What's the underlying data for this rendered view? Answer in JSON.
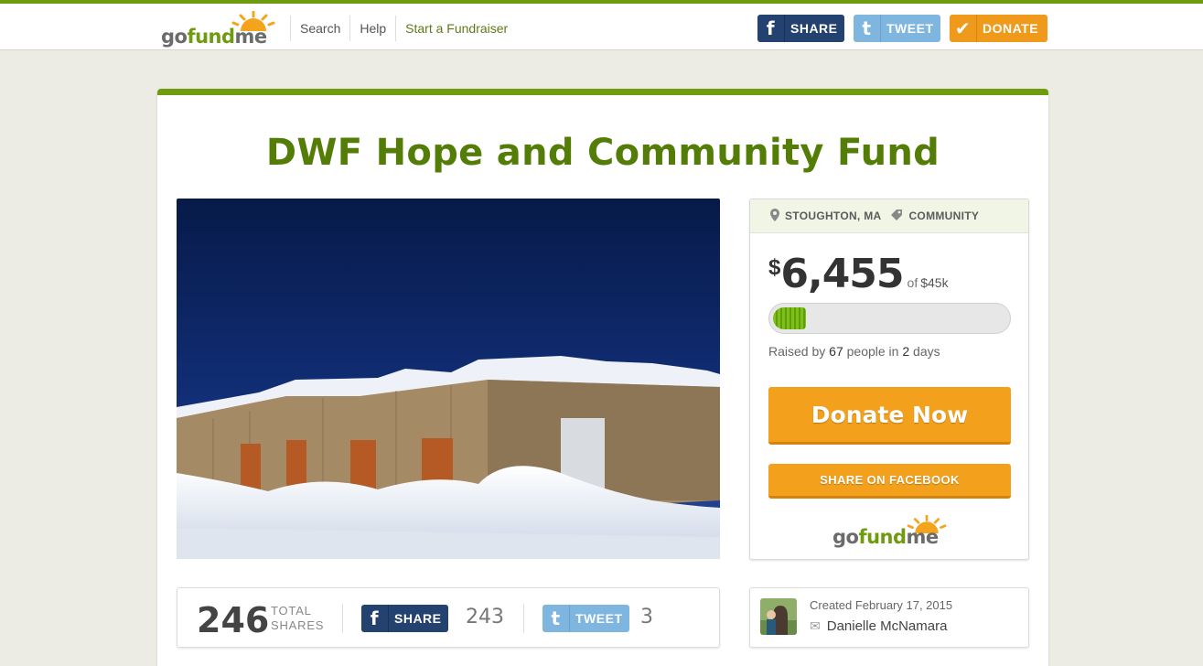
{
  "header": {
    "logo": {
      "go": "go",
      "fund": "fund",
      "me": "me"
    },
    "nav": [
      "Search",
      "Help",
      "Start a Fundraiser"
    ],
    "share_label": "SHARE",
    "tweet_label": "TWEET",
    "donate_label": "DONATE"
  },
  "campaign": {
    "title": "DWF Hope and Community Fund",
    "location": "STOUGHTON, MA",
    "category": "COMMUNITY",
    "currency": "$",
    "raised": "6,455",
    "of": "of",
    "goal": "$45k",
    "progress_fraction": 0.143,
    "raised_by_prefix": "Raised by",
    "people": "67",
    "people_mid": "people in",
    "days": "2",
    "days_suffix": "days",
    "donate_now": "Donate Now",
    "share_on_facebook": "SHARE ON FACEBOOK"
  },
  "shares": {
    "total": "246",
    "total_label_1": "TOTAL",
    "total_label_2": "SHARES",
    "fb_label": "SHARE",
    "fb_count": "243",
    "tw_label": "TWEET",
    "tw_count": "3"
  },
  "creator": {
    "created": "Created February 17, 2015",
    "name": "Danielle McNamara"
  },
  "colors": {
    "brand_green": "#6f9c0f",
    "title_green": "#537d07",
    "orange": "#f3a01c",
    "facebook": "#24426f",
    "twitter": "#7fb6e0"
  },
  "icons": {
    "facebook": "f",
    "twitter": "t",
    "check": "✔",
    "pin": "⬤",
    "tag": "◆",
    "mail": "✉"
  }
}
